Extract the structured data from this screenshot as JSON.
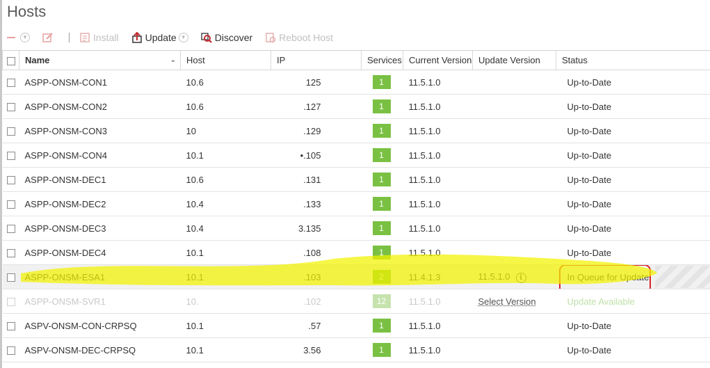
{
  "page": {
    "title": "Hosts"
  },
  "toolbar": {
    "install_label": "Install",
    "update_label": "Update",
    "discover_label": "Discover",
    "reboot_label": "Reboot Host"
  },
  "table": {
    "columns": [
      "Name",
      "Host",
      "IP",
      "Services",
      "Current Version",
      "Update Version",
      "Status"
    ],
    "rows": [
      {
        "name": "ASPP-ONSM-CON1",
        "host": "10.6",
        "ip": "125",
        "services": "1",
        "current": "11.5.1.0",
        "update": "",
        "status": "Up-to-Date"
      },
      {
        "name": "ASPP-ONSM-CON2",
        "host": "10.6",
        "ip": ".127",
        "services": "1",
        "current": "11.5.1.0",
        "update": "",
        "status": "Up-to-Date"
      },
      {
        "name": "ASPP-ONSM-CON3",
        "host": "10",
        "ip": ".129",
        "services": "1",
        "current": "11.5.1.0",
        "update": "",
        "status": "Up-to-Date"
      },
      {
        "name": "ASPP-ONSM-CON4",
        "host": "10.1",
        "ip": "•.105",
        "services": "1",
        "current": "11.5.1.0",
        "update": "",
        "status": "Up-to-Date"
      },
      {
        "name": "ASPP-ONSM-DEC1",
        "host": "10.6",
        "ip": ".131",
        "services": "1",
        "current": "11.5.1.0",
        "update": "",
        "status": "Up-to-Date"
      },
      {
        "name": "ASPP-ONSM-DEC2",
        "host": "10.4",
        "ip": ".133",
        "services": "1",
        "current": "11.5.1.0",
        "update": "",
        "status": "Up-to-Date"
      },
      {
        "name": "ASPP-ONSM-DEC3",
        "host": "10.4",
        "ip": "3.135",
        "services": "1",
        "current": "11.5.1.0",
        "update": "",
        "status": "Up-to-Date"
      },
      {
        "name": "ASPP-ONSM-DEC4",
        "host": "10.1",
        "ip": ".108",
        "services": "1",
        "current": "11.5.1.0",
        "update": "",
        "status": "Up-to-Date"
      },
      {
        "name": "ASPP-ONSM-ESA1",
        "host": "10.1",
        "ip": ".103",
        "services": "2",
        "current": "11.4.1.3",
        "update": "11.5.1.0",
        "status": "In Queue for Update"
      },
      {
        "name": "ASPP-ONSM-SVR1",
        "host": "10.",
        "ip": ".102",
        "services": "12",
        "current": "11.5.1.0",
        "update": "Select Version",
        "status": "Update Available"
      },
      {
        "name": "ASPV-ONSM-CON-CRPSQ",
        "host": "10.1",
        "ip": ".57",
        "services": "1",
        "current": "11.5.1.0",
        "update": "",
        "status": "Up-to-Date"
      },
      {
        "name": "ASPV-ONSM-DEC-CRPSQ",
        "host": "10.1",
        "ip": "3.56",
        "services": "1",
        "current": "11.5.1.0",
        "update": "",
        "status": "Up-to-Date"
      }
    ]
  },
  "colors": {
    "service_badge": "#7ac143",
    "highlight": "#f2f200",
    "annotation_circle": "#d8232a"
  }
}
